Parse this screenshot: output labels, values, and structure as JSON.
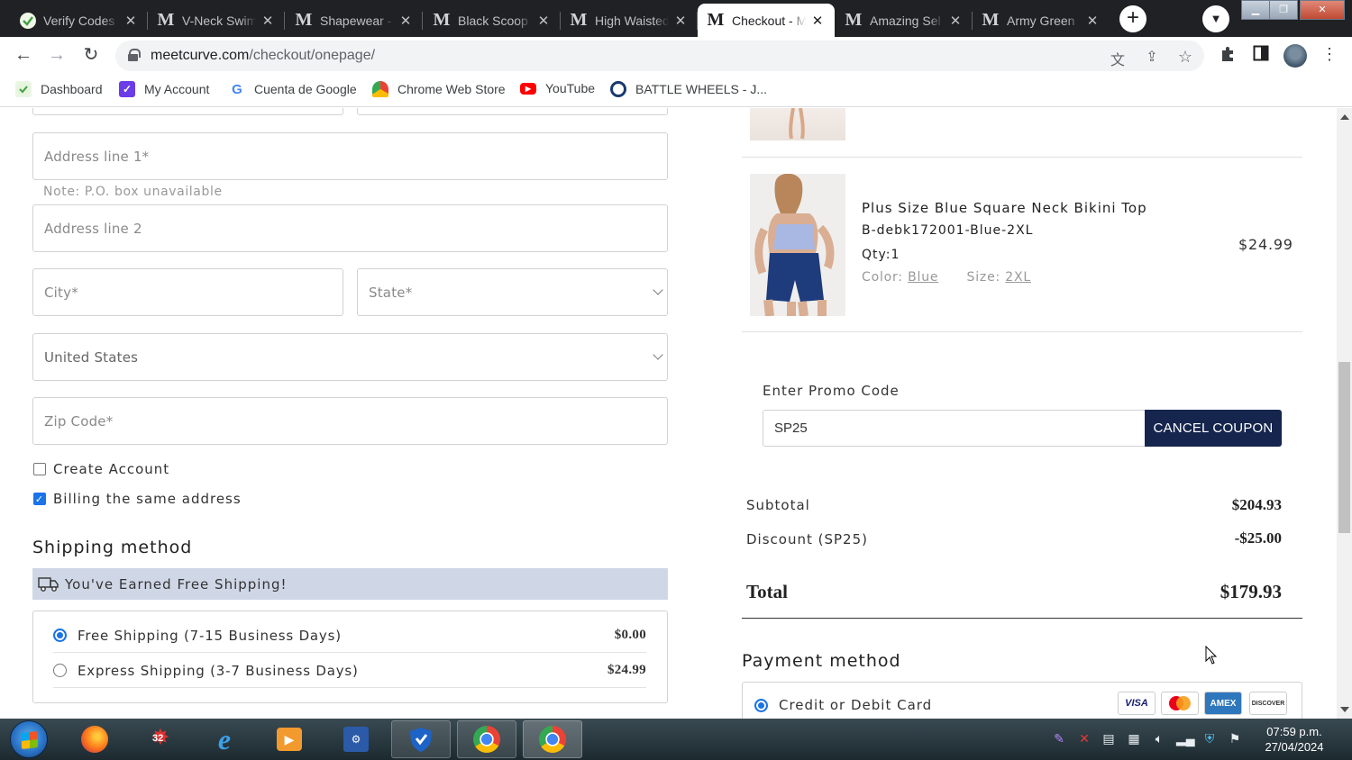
{
  "browser": {
    "tabs": [
      {
        "title": "Verify Codes",
        "icon": "verify-green-icon",
        "active": false
      },
      {
        "title": "V-Neck Swim",
        "icon": "meetcurve-m-icon",
        "active": false
      },
      {
        "title": "Shapewear -",
        "icon": "meetcurve-m-icon",
        "active": false
      },
      {
        "title": "Black Scoop",
        "icon": "meetcurve-m-icon",
        "active": false
      },
      {
        "title": "High Waisted",
        "icon": "meetcurve-m-icon",
        "active": false
      },
      {
        "title": "Checkout - M",
        "icon": "meetcurve-m-icon",
        "active": true
      },
      {
        "title": "Amazing Sel",
        "icon": "meetcurve-m-icon",
        "active": false
      },
      {
        "title": "Army Green",
        "icon": "meetcurve-m-icon",
        "active": false
      }
    ],
    "fav_letter": "M",
    "close_glyph": "✕",
    "url_host": "meetcurve.com",
    "url_path": "/checkout/onepage/",
    "bookmarks": [
      {
        "label": "Dashboard",
        "icon": "dashboard-icon"
      },
      {
        "label": "My Account",
        "icon": "my-account-icon"
      },
      {
        "label": "Cuenta de Google",
        "icon": "google-icon"
      },
      {
        "label": "Chrome Web Store",
        "icon": "chrome-web-store-icon"
      },
      {
        "label": "YouTube",
        "icon": "youtube-icon"
      },
      {
        "label": "BATTLE WHEELS - J...",
        "icon": "battle-wheels-icon"
      }
    ]
  },
  "shipping_form": {
    "address1_placeholder": "Address line 1*",
    "po_note": "Note: P.O. box unavailable",
    "address2_placeholder": "Address line 2",
    "city_placeholder": "City*",
    "state_placeholder": "State*",
    "country_value": "United States",
    "zip_placeholder": "Zip Code*",
    "create_account_label": "Create Account",
    "create_account_checked": false,
    "billing_same_label": "Billing the same address",
    "billing_same_checked": true
  },
  "shipping_method": {
    "heading": "Shipping method",
    "free_banner": "You've Earned Free Shipping!",
    "options": [
      {
        "label": "Free Shipping (7-15 Business Days)",
        "price": "$0.00",
        "selected": true
      },
      {
        "label": "Express Shipping (3-7 Business Days)",
        "price": "$24.99",
        "selected": false
      }
    ]
  },
  "cart_item": {
    "name": "Plus Size Blue Square Neck Bikini Top",
    "sku": "B-debk172001-Blue-2XL",
    "qty": "Qty:1",
    "color_label": "Color:",
    "color_value": "Blue",
    "size_label": "Size:",
    "size_value": "2XL",
    "price": "$24.99"
  },
  "promo": {
    "label": "Enter Promo Code",
    "code": "SP25",
    "button_label": "CANCEL COUPON"
  },
  "summary": {
    "subtotal_label": "Subtotal",
    "subtotal_value": "$204.93",
    "discount_label": "Discount (SP25)",
    "discount_value": "-$25.00",
    "total_label": "Total",
    "total_value": "$179.93"
  },
  "payment": {
    "heading": "Payment method",
    "option_label": "Credit or Debit Card",
    "cards": [
      "VISA",
      "mastercard",
      "AMEX",
      "DISCOVER"
    ]
  },
  "taskbar": {
    "time": "07:59 p.m.",
    "date": "27/04/2024",
    "badge": "32"
  },
  "colors": {
    "accent_blue": "#1a73e8",
    "coupon_button": "#15254d",
    "free_banner_bg": "#cfd7e6"
  }
}
